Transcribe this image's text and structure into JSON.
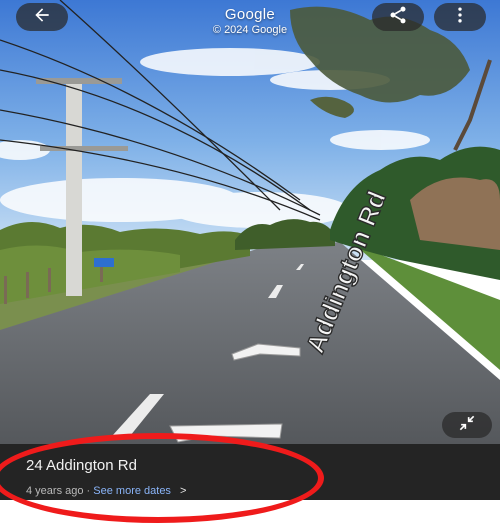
{
  "header": {
    "title": "Google",
    "copyright": "© 2024 Google",
    "back_icon": "arrow-left-icon",
    "share_icon": "share-icon",
    "menu_icon": "more-vert-icon"
  },
  "scene": {
    "road_marking_text": "Addington Rd"
  },
  "controls": {
    "collapse_icon": "collapse-arrows-icon"
  },
  "info_panel": {
    "address": "24 Addington Rd",
    "capture_age": "4 years ago",
    "separator": "·",
    "more_dates_label": "See more dates",
    "chevron": ">"
  },
  "colors": {
    "panel_bg": "#242424",
    "link": "#8ab4f8",
    "highlight": "#ef1b1b"
  }
}
